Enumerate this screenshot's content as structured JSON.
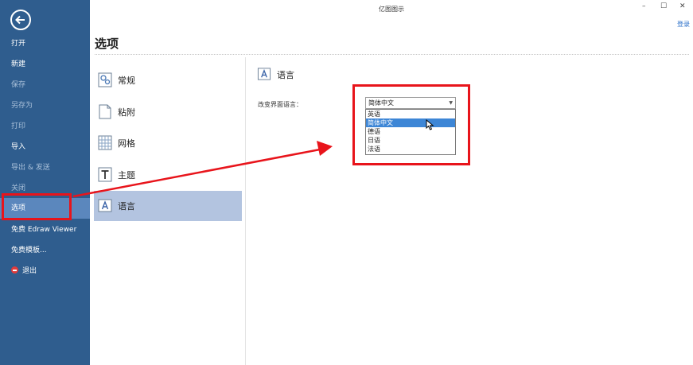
{
  "window": {
    "title": "亿图图示",
    "minimize": "–",
    "maximize": "☐",
    "close": "✕",
    "login": "登录"
  },
  "sidebar": {
    "items": [
      {
        "label": "打开"
      },
      {
        "label": "新建"
      },
      {
        "label": "保存"
      },
      {
        "label": "另存为"
      },
      {
        "label": "打印"
      },
      {
        "label": "导入"
      },
      {
        "label": "导出 & 发送"
      },
      {
        "label": "关闭"
      },
      {
        "label": "选项"
      },
      {
        "label": "免费 Edraw Viewer"
      },
      {
        "label": "免费模板..."
      },
      {
        "label": "退出"
      }
    ]
  },
  "page": {
    "title": "选项"
  },
  "categories": [
    {
      "label": "常规"
    },
    {
      "label": "粘附"
    },
    {
      "label": "网格"
    },
    {
      "label": "主题"
    },
    {
      "label": "语言"
    }
  ],
  "language": {
    "section_title": "语言",
    "field_label": "改变界面语言：",
    "selected": "简体中文",
    "options": [
      "英语",
      "简体中文",
      "德语",
      "日语",
      "法语"
    ]
  },
  "colors": {
    "sidebar_bg": "#2f5d8e",
    "accent_highlight": "#e8141b",
    "selection": "#3d86d6"
  }
}
